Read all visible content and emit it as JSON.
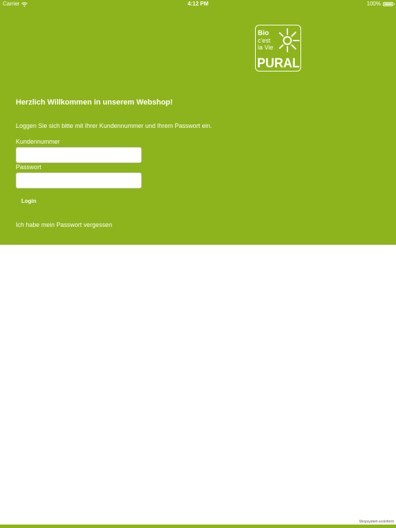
{
  "status_bar": {
    "carrier": "Carrier",
    "time": "4:12 PM",
    "battery_text": "100%",
    "battery_level": 1.0
  },
  "logo": {
    "lines": [
      "Bio",
      "c'est",
      "la Vie",
      "PURAL"
    ],
    "icon": "sun-icon"
  },
  "login_form": {
    "welcome": "Herzlich Willkommen in unserem Webshop!",
    "instruction": "Loggen Sie sich bitte mit Ihrer Kundennummer und Ihrem Passwort ein.",
    "customer_number_label": "Kundennummer",
    "customer_number_value": "",
    "password_label": "Passwort",
    "password_value": "",
    "login_button": "Login",
    "forgot_password": "Ich habe mein Passwort vergessen"
  },
  "footer": {
    "credit": "Shopsystem ecoinform"
  },
  "colors": {
    "brand_green": "#8db41c",
    "text_light": "#ffffff"
  }
}
